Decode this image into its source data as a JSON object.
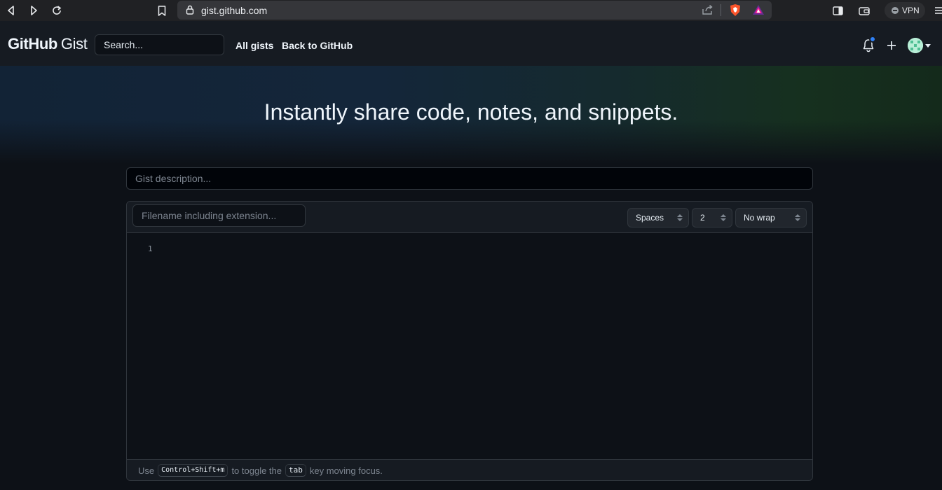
{
  "browser": {
    "url": "gist.github.com",
    "vpn_label": "VPN"
  },
  "header": {
    "logo_github": "GitHub",
    "logo_gist": "Gist",
    "search_placeholder": "Search...",
    "nav": [
      "All gists",
      "Back to GitHub"
    ]
  },
  "hero": {
    "title": "Instantly share code, notes, and snippets."
  },
  "form": {
    "description_placeholder": "Gist description...",
    "filename_placeholder": "Filename including extension...",
    "indent_mode": "Spaces",
    "indent_size": "2",
    "wrap_mode": "No wrap",
    "line_numbers": [
      "1"
    ]
  },
  "footer": {
    "text_before": "Use",
    "shortcut": "Control+Shift+m",
    "text_middle": "to toggle the",
    "key": "tab",
    "text_after": "key moving focus."
  },
  "colors": {
    "page_bg": "#0d1117",
    "header_bg": "#161b22",
    "border": "#30363d",
    "accent_dot": "#2f81f7"
  }
}
